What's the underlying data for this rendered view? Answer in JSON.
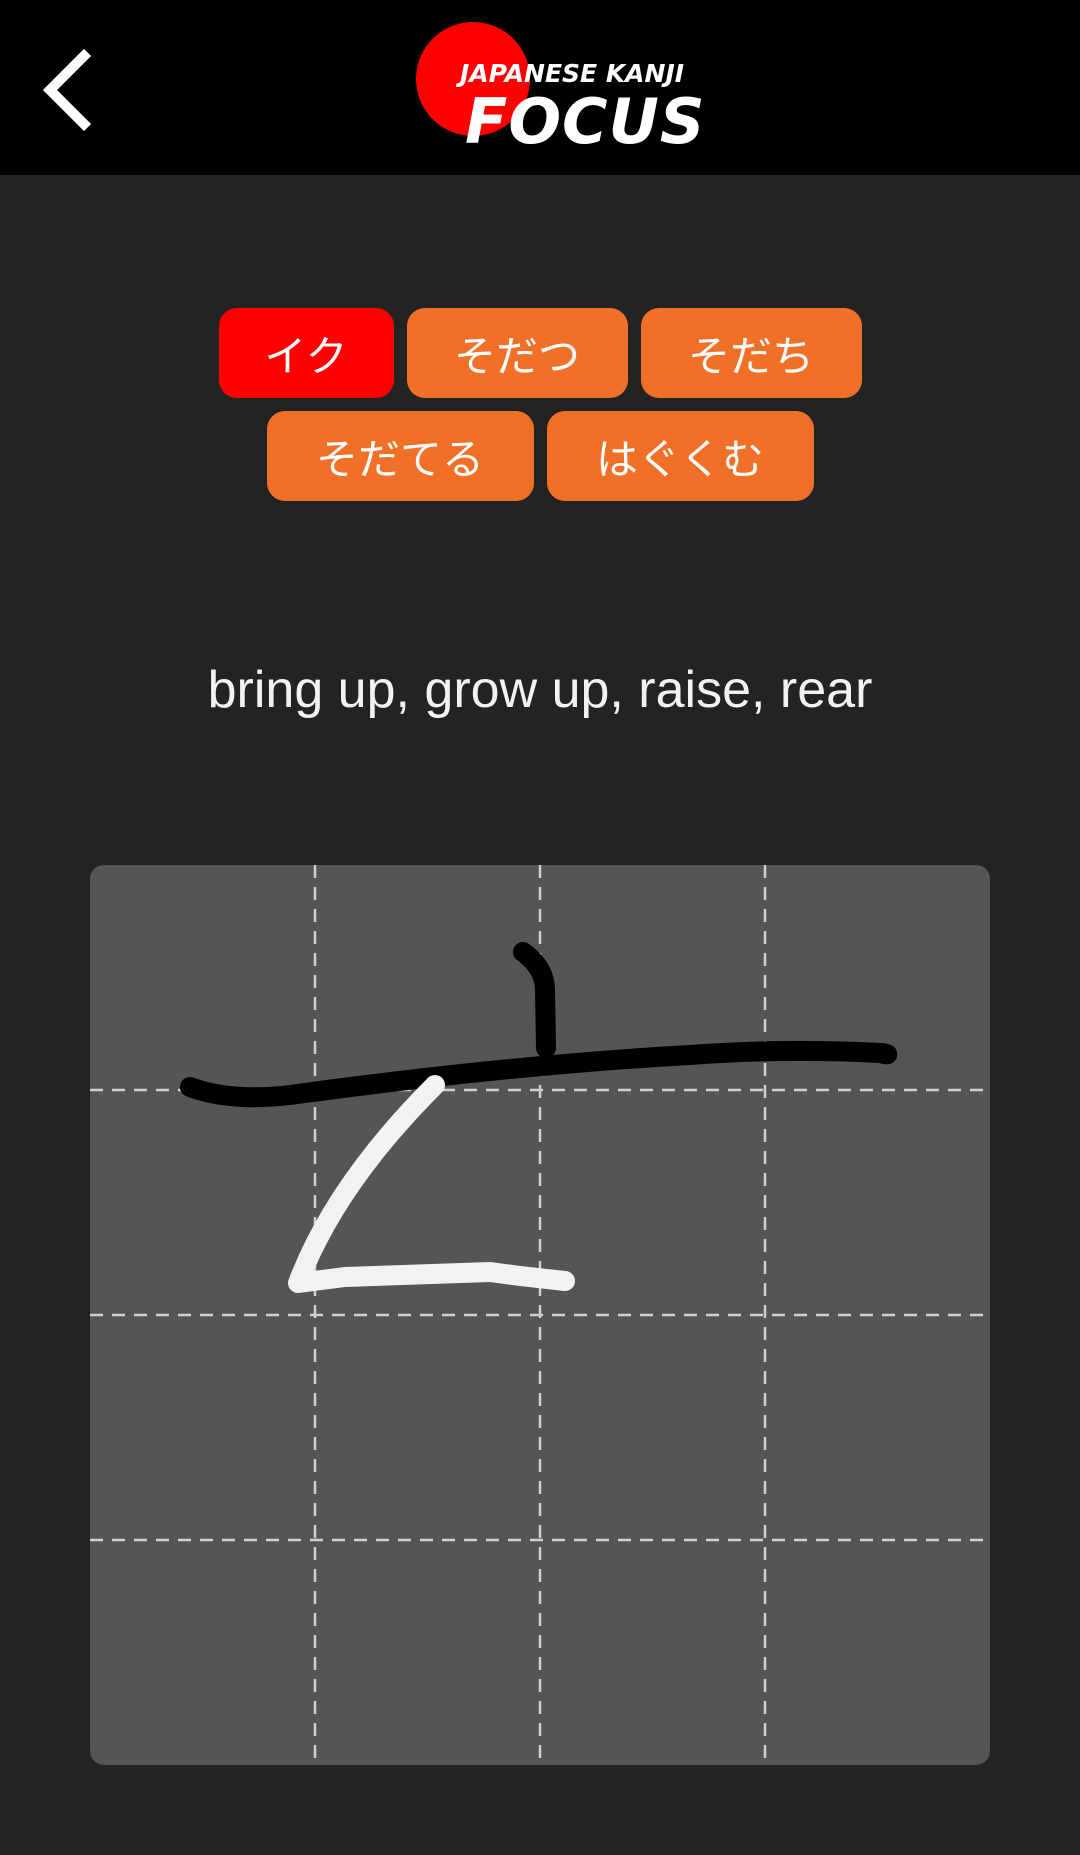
{
  "header": {
    "back_icon": "chevron-left-icon",
    "logo": {
      "top_text": "JAPANESE KANJI",
      "main_text": "FOCUS",
      "sun_color": "#ff0000"
    }
  },
  "readings": {
    "rows": [
      [
        {
          "label": "イク",
          "active": true
        },
        {
          "label": "そだつ",
          "active": false
        },
        {
          "label": "そだち",
          "active": false
        }
      ],
      [
        {
          "label": "そだてる",
          "active": false
        },
        {
          "label": "はぐくむ",
          "active": false
        }
      ]
    ],
    "active_color": "#ff0000",
    "inactive_color": "#f07028"
  },
  "meaning": "bring up, grow up, raise, rear",
  "drawing_canvas": {
    "background": "#555555",
    "grid_color": "#cfcfcf",
    "reference_stroke_color": "#000000",
    "user_stroke_color": "#f2f2f2"
  }
}
